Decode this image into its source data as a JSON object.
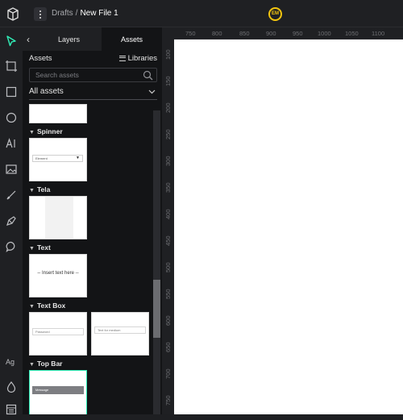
{
  "header": {
    "breadcrumb_parent": "Drafts",
    "breadcrumb_separator": "/",
    "file_name": "New File 1",
    "avatar_initials": "EM"
  },
  "panel": {
    "tabs": [
      "Layers",
      "Assets"
    ],
    "active_tab": "Assets",
    "assets_title": "Assets",
    "libraries_label": "Libraries",
    "search_placeholder": "Search assets",
    "filter_value": "All assets"
  },
  "asset_groups": [
    {
      "title": "Spinner",
      "card_text": "Element"
    },
    {
      "title": "Tela"
    },
    {
      "title": "Text",
      "card_text": "-- Insert text here --"
    },
    {
      "title": "Text Box",
      "card_texts": [
        "Password",
        "Text for medium"
      ]
    },
    {
      "title": "Top Bar",
      "card_text": "Message"
    }
  ],
  "ruler": {
    "top": [
      "750",
      "800",
      "850",
      "900",
      "950",
      "1000",
      "1050",
      "1100"
    ],
    "left": [
      "100",
      "150",
      "200",
      "250",
      "300",
      "350",
      "400",
      "450",
      "500",
      "550",
      "600",
      "650",
      "700",
      "750"
    ]
  },
  "colors": {
    "accent": "#31efb8",
    "avatar_ring": "#f1c40f",
    "background": "#1e1f22"
  },
  "tool_icons": [
    "move-tool-icon",
    "board-tool-icon",
    "rectangle-tool-icon",
    "ellipse-tool-icon",
    "text-tool-icon",
    "image-tool-icon",
    "curve-tool-icon",
    "path-tool-icon",
    "comments-tool-icon",
    "typography-icon",
    "color-palette-icon",
    "text-palette-icon"
  ]
}
